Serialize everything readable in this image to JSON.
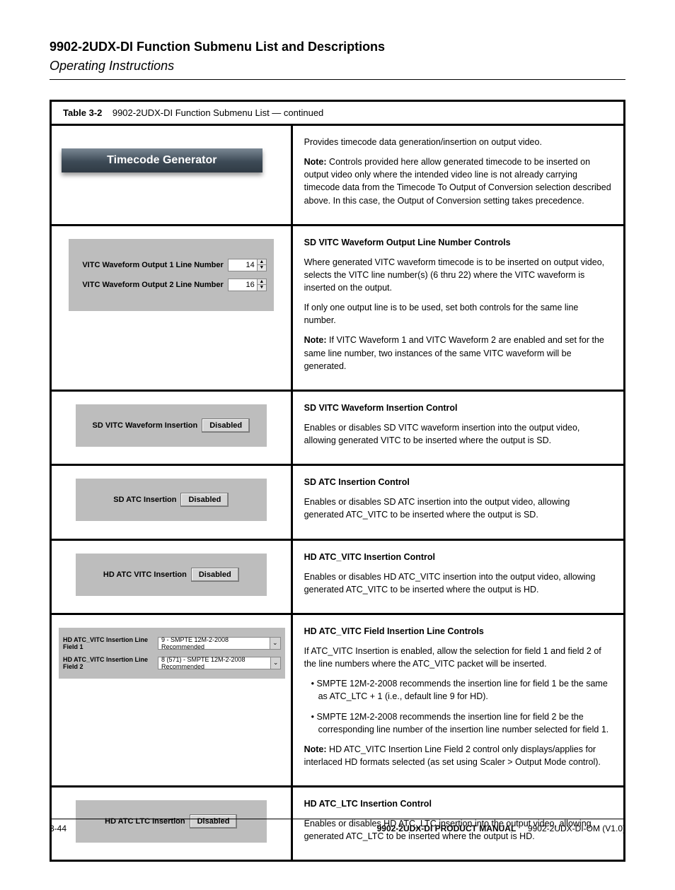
{
  "header": {
    "title": "9902-2UDX-DI Function Submenu List and Descriptions",
    "chapter": "Operating Instructions"
  },
  "table_caption": {
    "prefix": "Table 3-2",
    "title": "9902-2UDX-DI Function Submenu List — continued"
  },
  "section_banner": "Timecode Generator",
  "rows": {
    "tc_gen_desc": "Provides timecode data generation/insertion on output video.",
    "tc_gen_note_label": "Note:",
    "tc_gen_note": "Controls provided here allow generated timecode to be inserted on output video only where the intended video line is not already carrying timecode data from the Timecode To Output of Conversion selection described above. In this case, the Output of Conversion setting takes precedence.",
    "vitc_out1_label": "VITC Waveform Output 1 Line Number",
    "vitc_out1_value": "14",
    "vitc_out2_label": "VITC Waveform Output 2 Line Number",
    "vitc_out2_value": "16",
    "vitc_ctrl_heading": "SD VITC Waveform Output Line Number Controls",
    "vitc_ctrl_p1": "Where generated VITC waveform timecode is to be inserted on output video, selects the VITC line number(s) (6 thru 22) where the VITC waveform is inserted on the output.",
    "vitc_ctrl_p2": "If only one output line is to be used, set both controls for the same line number.",
    "vitc_ctrl_note_label": "Note:",
    "vitc_ctrl_note": "If VITC Waveform 1 and VITC Waveform 2 are enabled and set for the same line number, two instances of the same VITC waveform will be generated.",
    "sd_vitc_label": "SD VITC Waveform Insertion",
    "sd_vitc_btn": "Disabled",
    "sd_vitc_heading": "SD VITC Waveform Insertion Control",
    "sd_vitc_desc": "Enables or disables SD VITC waveform insertion into the output video, allowing generated VITC to be inserted where the output is SD.",
    "sd_atc_label": "SD ATC Insertion",
    "sd_atc_btn": "Disabled",
    "sd_atc_heading": "SD ATC Insertion Control",
    "sd_atc_desc": "Enables or disables SD ATC insertion into the output video, allowing generated ATC_VITC to be inserted where the output is SD.",
    "hd_atc_vitc_label": "HD ATC VITC Insertion",
    "hd_atc_vitc_btn": "Disabled",
    "hd_atc_vitc_heading": "HD ATC_VITC Insertion Control",
    "hd_atc_vitc_desc": "Enables or disables HD ATC_VITC insertion into the output video, allowing generated ATC_VITC to be inserted where the output is HD.",
    "hd_atc_line_heading": "HD ATC_VITC Field Insertion Line Controls",
    "hd_atc_line_desc": "If ATC_VITC Insertion is enabled, allow the selection for field 1 and field 2 of the line numbers where the ATC_VITC packet will be inserted.",
    "hd_atc_line_f1_label": "HD ATC_VITC Insertion Line Field 1",
    "hd_atc_line_f1_value": "9 - SMPTE 12M-2-2008 Recommended",
    "hd_atc_line_f2_label": "HD ATC_VITC Insertion Line Field 2",
    "hd_atc_line_f2_value": "8 (571) - SMPTE 12M-2-2008 Recommended",
    "hd_atc_bullet1": "SMPTE 12M-2-2008 recommends the insertion line for field 1 be the same as ATC_LTC + 1 (i.e., default line 9 for HD).",
    "hd_atc_bullet2": "SMPTE 12M-2-2008 recommends the insertion line for field 2 be the corresponding line number of the insertion line number selected for field 1.",
    "hd_atc_line_note_label": "Note:",
    "hd_atc_line_note": "HD ATC_VITC Insertion Line Field 2 control only displays/applies for interlaced HD formats selected (as set using Scaler > Output Mode control).",
    "hd_atc_ltc_label": "HD ATC LTC Insertion",
    "hd_atc_ltc_btn": "Disabled",
    "hd_atc_ltc_heading": "HD ATC_LTC Insertion Control",
    "hd_atc_ltc_desc": "Enables or disables HD ATC_LTC insertion into the output video, allowing generated ATC_LTC to be inserted where the output is HD."
  },
  "footer": {
    "left": "3-44",
    "right_bold": "9902-2UDX-DI PRODUCT MANUAL",
    "right_rev": "9902-2UDX-DI-OM (V1.0)"
  }
}
